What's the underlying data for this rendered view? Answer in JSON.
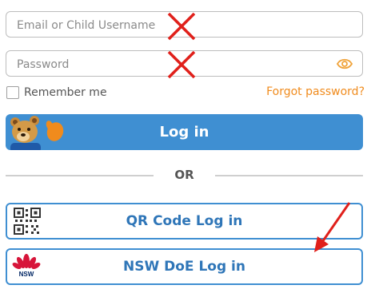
{
  "form": {
    "email_placeholder": "Email or Child Username",
    "password_placeholder": "Password",
    "remember_label": "Remember me",
    "forgot_label": "Forgot password?",
    "login_label": "Log in",
    "or_label": "OR",
    "qr_label": "QR Code Log in",
    "nsw_label": "NSW DoE Log in",
    "nsw_logo_text": "NSW"
  },
  "icons": {
    "eye": "eye-icon",
    "qr": "qr-code-icon",
    "nsw": "nsw-government-logo-icon",
    "mascot": "bear-mascot-icon"
  },
  "annotations": {
    "cross_marks": 2,
    "arrow_target": "NSW DoE Log in"
  },
  "colors": {
    "accent": "#3f8fd2",
    "link": "#f08b1d",
    "annotation": "#e0201b"
  }
}
